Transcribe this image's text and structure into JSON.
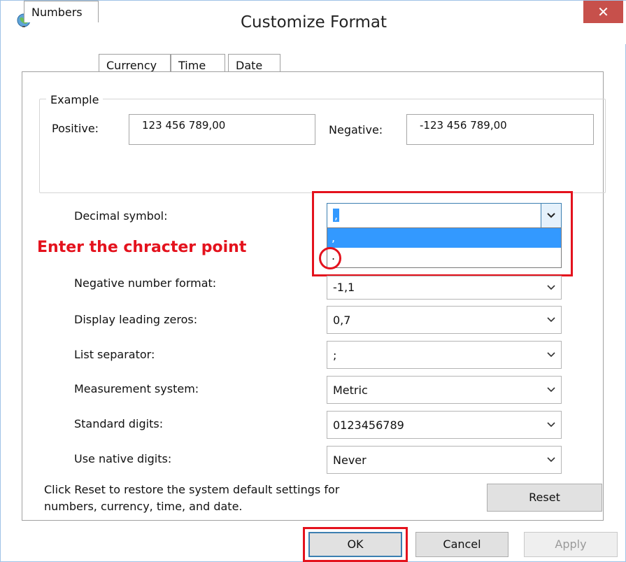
{
  "window": {
    "title": "Customize Format",
    "close_symbol": "✕"
  },
  "tabs": [
    {
      "label": "Numbers",
      "active": true
    },
    {
      "label": "Currency",
      "active": false
    },
    {
      "label": "Time",
      "active": false
    },
    {
      "label": "Date",
      "active": false
    }
  ],
  "example": {
    "group_label": "Example",
    "positive_label": "Positive:",
    "positive_value": "123 456 789,00",
    "negative_label": "Negative:",
    "negative_value": "-123 456 789,00"
  },
  "settings": [
    {
      "key": "decimal_symbol",
      "label": "Decimal symbol:",
      "value": ","
    },
    {
      "key": "negative_number_format",
      "label": "Negative number format:",
      "value": "-1,1"
    },
    {
      "key": "display_leading_zeros",
      "label": "Display leading zeros:",
      "value": "0,7"
    },
    {
      "key": "list_separator",
      "label": "List separator:",
      "value": ";"
    },
    {
      "key": "measurement_system",
      "label": "Measurement system:",
      "value": "Metric"
    },
    {
      "key": "standard_digits",
      "label": "Standard digits:",
      "value": "0123456789"
    },
    {
      "key": "use_native_digits",
      "label": "Use native digits:",
      "value": "Never"
    }
  ],
  "decimal_dropdown": {
    "options": [
      ",",
      "."
    ],
    "highlighted_index": 0
  },
  "annotation": {
    "text": "Enter the chracter point",
    "color": "#e4121d"
  },
  "reset": {
    "info_line1": "Click Reset to restore the system default settings for",
    "info_line2": "numbers, currency, time, and date.",
    "button": "Reset"
  },
  "buttons": {
    "ok": "OK",
    "cancel": "Cancel",
    "apply": "Apply"
  },
  "icons": {
    "app": "globe-icon",
    "close": "close-icon",
    "dropdown": "chevron-down-icon"
  },
  "colors": {
    "close_bg": "#c7504b",
    "highlight": "#3399ff",
    "focus_border": "#3c7fb1"
  }
}
